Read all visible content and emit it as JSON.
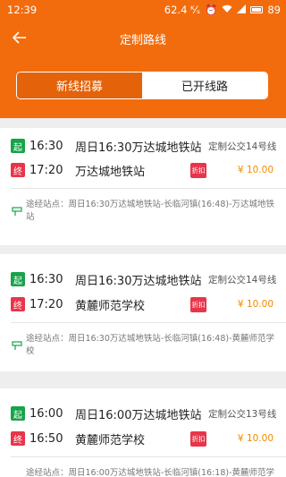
{
  "status_bar": {
    "time": "12:39",
    "signal_text": "62.4 ᴷ⁄ₛ",
    "battery": "89"
  },
  "nav": {
    "title": "定制路线"
  },
  "tabs": [
    {
      "label": "新线招募",
      "active": false
    },
    {
      "label": "已开线路",
      "active": true
    }
  ],
  "routes": [
    {
      "start_tag": "起",
      "start_time": "16:30",
      "start_place": "周日16:30万达城地铁站",
      "route_no": "定制公交14号线",
      "end_tag": "终",
      "end_time": "17:20",
      "end_place": "万达城地铁站",
      "discount": "折扣",
      "price": "¥ 10.00",
      "stops": "途经站点：周日16:30万达城地铁站-长临河镇(16:48)-万达城地铁站"
    },
    {
      "start_tag": "起",
      "start_time": "16:30",
      "start_place": "周日16:30万达城地铁站",
      "route_no": "定制公交14号线",
      "end_tag": "终",
      "end_time": "17:20",
      "end_place": "黄麓师范学校",
      "discount": "折扣",
      "price": "¥ 10.00",
      "stops": "途经站点：周日16:30万达城地铁站-长临河镇(16:48)-黄麓师范学校"
    },
    {
      "start_tag": "起",
      "start_time": "16:00",
      "start_place": "周日16:00万达城地铁站",
      "route_no": "定制公交13号线",
      "end_tag": "终",
      "end_time": "16:50",
      "end_place": "黄麓师范学校",
      "discount": "折扣",
      "price": "¥ 10.00",
      "stops": "途经站点：周日16:00万达城地铁站-长临河镇(16:18)-黄麓师范学校"
    }
  ],
  "colors": {
    "accent": "#f26c0e",
    "start_tag": "#17a34a",
    "end_tag": "#e8354a",
    "price": "#f08a00"
  },
  "icons": {
    "back": "arrow-left-icon",
    "stops": "route-stops-icon"
  }
}
